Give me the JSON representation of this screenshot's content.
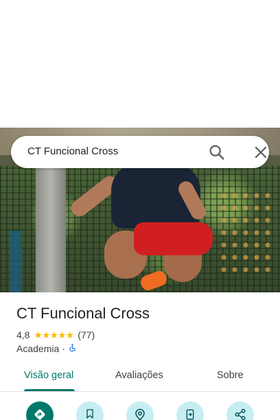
{
  "search": {
    "query": "CT Funcional Cross",
    "search_icon": "search-icon",
    "close_icon": "close-icon"
  },
  "place": {
    "name": "CT Funcional Cross",
    "rating": "4,8",
    "stars": 5,
    "review_count": "(77)",
    "category": "Academia",
    "separator": "·",
    "accessibility_icon": "wheelchair-icon"
  },
  "tabs": [
    {
      "label": "Visão geral",
      "active": true
    },
    {
      "label": "Avaliações",
      "active": false
    },
    {
      "label": "Sobre",
      "active": false
    }
  ],
  "actions": [
    {
      "icon": "directions-icon",
      "primary": true
    },
    {
      "icon": "bookmark-icon",
      "primary": false
    },
    {
      "icon": "nearby-icon",
      "primary": false
    },
    {
      "icon": "send-to-phone-icon",
      "primary": false
    },
    {
      "icon": "share-icon",
      "primary": false
    }
  ],
  "colors": {
    "accent": "#00796b",
    "action_bg": "#c6eef2",
    "star": "#fbbc04",
    "accessibility": "#1a73e8"
  }
}
